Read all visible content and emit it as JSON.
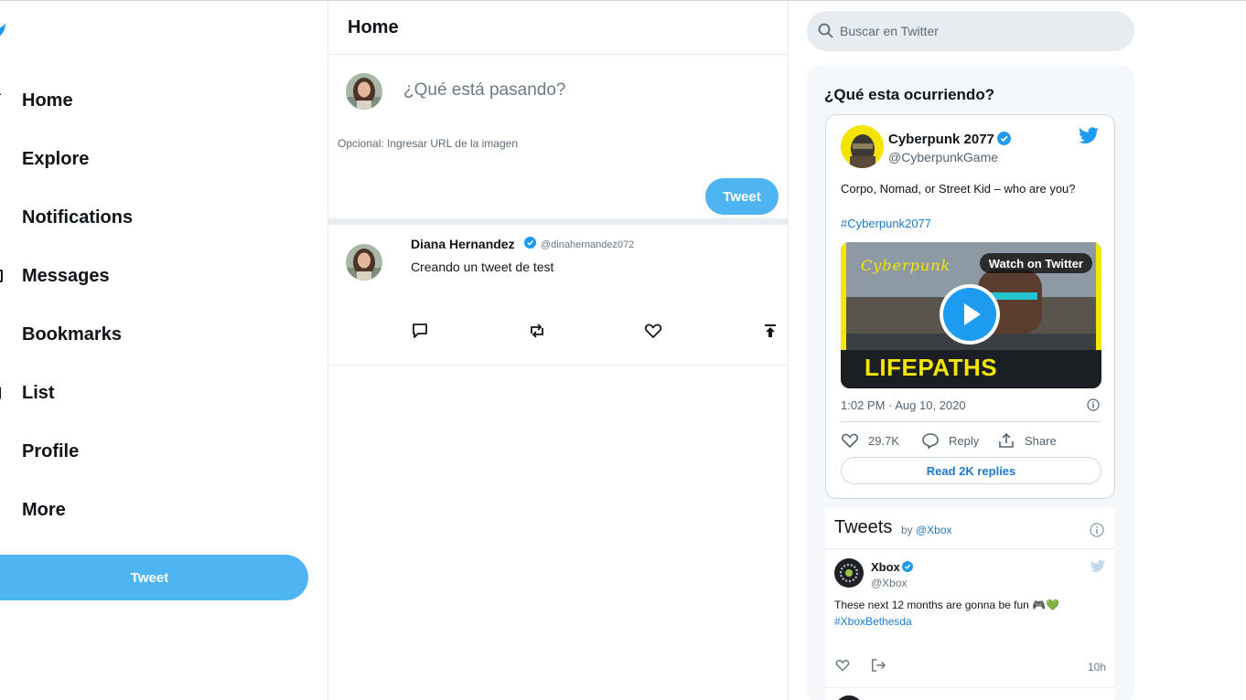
{
  "sidebar": {
    "logo_icon": "twitter-bird-icon",
    "items": [
      {
        "label": "Home",
        "icon": "home-icon"
      },
      {
        "label": "Explore",
        "icon": "hashtag-icon"
      },
      {
        "label": "Notifications",
        "icon": "bell-icon"
      },
      {
        "label": "Messages",
        "icon": "envelope-icon"
      },
      {
        "label": "Bookmarks",
        "icon": "bookmark-icon"
      },
      {
        "label": "List",
        "icon": "list-icon"
      },
      {
        "label": "Profile",
        "icon": "user-icon"
      },
      {
        "label": "More",
        "icon": "more-icon"
      }
    ],
    "tweet_button": "Tweet"
  },
  "center": {
    "title": "Home",
    "composer": {
      "placeholder": "¿Qué está pasando?",
      "url_placeholder": "Opcional: Ingresar URL de la imagen",
      "button": "Tweet"
    },
    "tweets": [
      {
        "name": "Diana Hernandez",
        "verified": true,
        "handle": "@dinahernandez072",
        "text": "Creando un tweet de test",
        "actions": [
          "reply-icon",
          "retweet-icon",
          "like-icon",
          "share-icon"
        ]
      }
    ]
  },
  "right": {
    "search_placeholder": "Buscar en Twitter",
    "trends_title": "¿Qué esta ocurriendo?",
    "embed": {
      "name": "Cyberpunk 2077",
      "handle": "@CyberpunkGame",
      "text": "Corpo, Nomad, or Street Kid – who are you?",
      "hashtag": "#Cyberpunk2077",
      "media_brand": "Cyberpunk",
      "media_watch": "Watch on Twitter",
      "media_title": "LIFEPATHS",
      "time": "1:02 PM · Aug 10, 2020",
      "likes": "29.7K",
      "reply": "Reply",
      "share": "Share",
      "read_replies": "Read 2K replies"
    },
    "timeline": {
      "title": "Tweets",
      "by": "by",
      "handle": "@Xbox",
      "tweet": {
        "name": "Xbox",
        "handle": "@Xbox",
        "text": "These next 12 months are gonna be fun 🎮💚",
        "hashtag": "#XboxBethesda",
        "time": "10h"
      }
    }
  },
  "colors": {
    "accent": "#4fb4f2",
    "link": "#1b7acf",
    "twitter_blue": "#1d9bf0",
    "verified": "#1d9bf0"
  }
}
